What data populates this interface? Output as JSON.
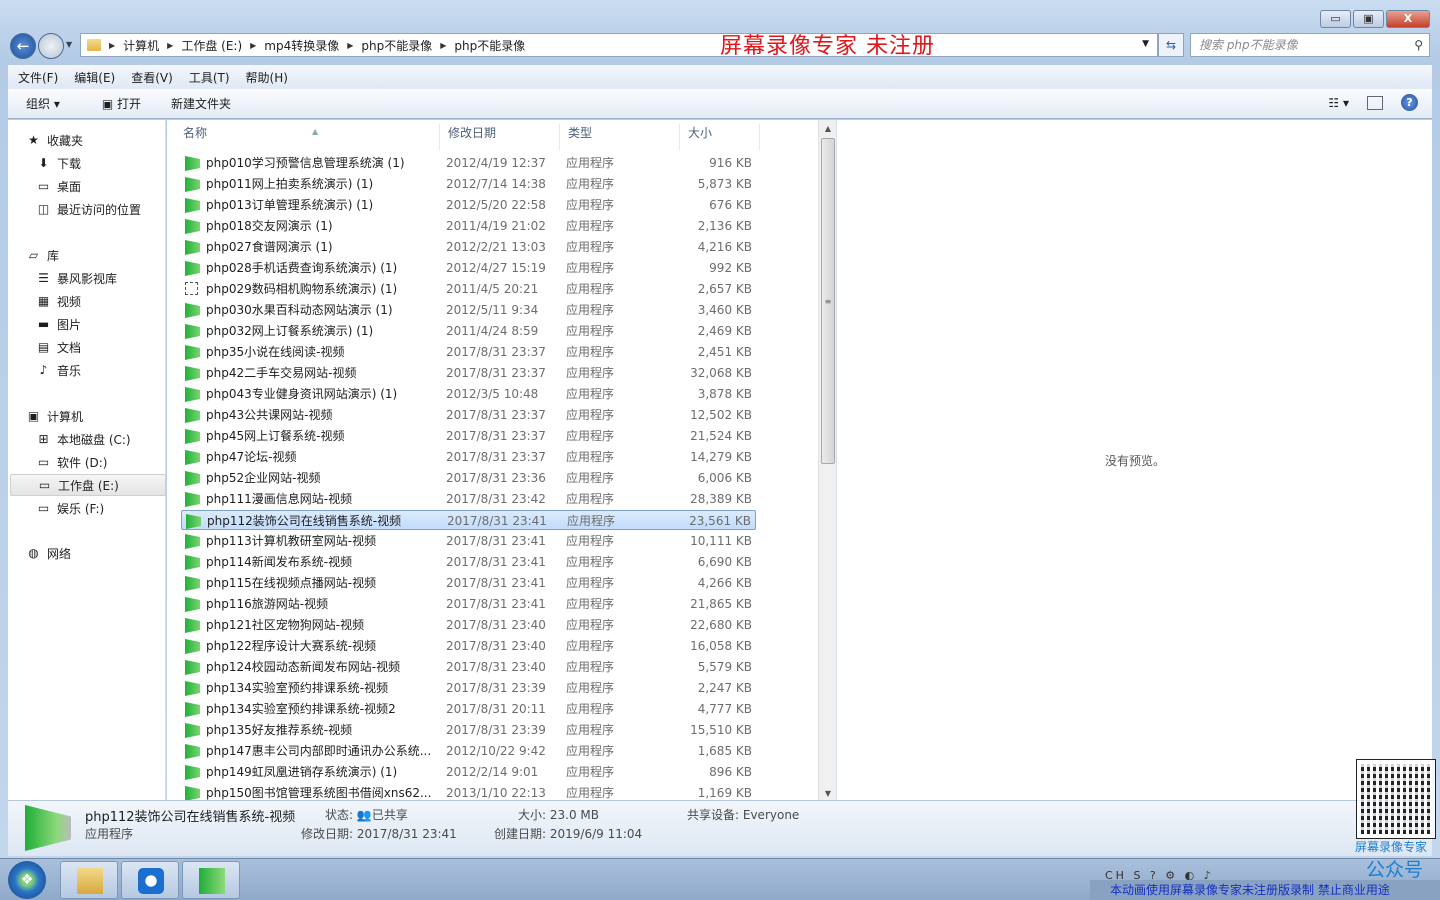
{
  "window": {
    "controls": {
      "minimize": "▭",
      "maximize": "▣",
      "close": "X"
    }
  },
  "watermark_title": "屏幕录像专家  未注册",
  "address": {
    "crumbs": [
      "计算机",
      "工作盘 (E:)",
      "mp4转换录像",
      "php不能录像",
      "php不能录像"
    ]
  },
  "search": {
    "placeholder": "搜索 php不能录像"
  },
  "menu": [
    "文件(F)",
    "编辑(E)",
    "查看(V)",
    "工具(T)",
    "帮助(H)"
  ],
  "toolbar": {
    "organize": "组织 ▾",
    "open": "打开",
    "new_folder": "新建文件夹"
  },
  "nav": {
    "favorites": {
      "label": "收藏夹",
      "items": [
        "下载",
        "桌面",
        "最近访问的位置"
      ]
    },
    "libraries": {
      "label": "库",
      "items": [
        "暴风影视库",
        "视频",
        "图片",
        "文档",
        "音乐"
      ]
    },
    "computer": {
      "label": "计算机",
      "items": [
        "本地磁盘 (C:)",
        "软件 (D:)",
        "工作盘 (E:)",
        "娱乐 (F:)"
      ],
      "selected": "工作盘 (E:)"
    },
    "network": {
      "label": "网络"
    }
  },
  "columns": [
    "名称",
    "修改日期",
    "类型",
    "大小"
  ],
  "files": [
    {
      "name": "php010学习预警信息管理系统演 (1)",
      "date": "2012/4/19 12:37",
      "type": "应用程序",
      "size": "916 KB"
    },
    {
      "name": "php011网上拍卖系统演示) (1)",
      "date": "2012/7/14 14:38",
      "type": "应用程序",
      "size": "5,873 KB"
    },
    {
      "name": "php013订单管理系统演示) (1)",
      "date": "2012/5/20 22:58",
      "type": "应用程序",
      "size": "676 KB"
    },
    {
      "name": "php018交友网演示 (1)",
      "date": "2011/4/19 21:02",
      "type": "应用程序",
      "size": "2,136 KB"
    },
    {
      "name": "php027食谱网演示 (1)",
      "date": "2012/2/21 13:03",
      "type": "应用程序",
      "size": "4,216 KB"
    },
    {
      "name": "php028手机话费查询系统演示) (1)",
      "date": "2012/4/27 15:19",
      "type": "应用程序",
      "size": "992 KB"
    },
    {
      "name": "php029数码相机购物系统演示) (1)",
      "date": "2011/4/5 20:21",
      "type": "应用程序",
      "size": "2,657 KB",
      "icon": "generic-exe"
    },
    {
      "name": "php030水果百科动态网站演示 (1)",
      "date": "2012/5/11 9:34",
      "type": "应用程序",
      "size": "3,460 KB"
    },
    {
      "name": "php032网上订餐系统演示) (1)",
      "date": "2011/4/24 8:59",
      "type": "应用程序",
      "size": "2,469 KB"
    },
    {
      "name": "php35小说在线阅读-视频",
      "date": "2017/8/31 23:37",
      "type": "应用程序",
      "size": "2,451 KB"
    },
    {
      "name": "php42二手车交易网站-视频",
      "date": "2017/8/31 23:37",
      "type": "应用程序",
      "size": "32,068 KB"
    },
    {
      "name": "php043专业健身资讯网站演示) (1)",
      "date": "2012/3/5 10:48",
      "type": "应用程序",
      "size": "3,878 KB"
    },
    {
      "name": "php43公共课网站-视频",
      "date": "2017/8/31 23:37",
      "type": "应用程序",
      "size": "12,502 KB"
    },
    {
      "name": "php45网上订餐系统-视频",
      "date": "2017/8/31 23:37",
      "type": "应用程序",
      "size": "21,524 KB"
    },
    {
      "name": "php47论坛-视频",
      "date": "2017/8/31 23:37",
      "type": "应用程序",
      "size": "14,279 KB"
    },
    {
      "name": "php52企业网站-视频",
      "date": "2017/8/31 23:36",
      "type": "应用程序",
      "size": "6,006 KB"
    },
    {
      "name": "php111漫画信息网站-视频",
      "date": "2017/8/31 23:42",
      "type": "应用程序",
      "size": "28,389 KB"
    },
    {
      "name": "php112装饰公司在线销售系统-视频",
      "date": "2017/8/31 23:41",
      "type": "应用程序",
      "size": "23,561 KB",
      "selected": true
    },
    {
      "name": "php113计算机教研室网站-视频",
      "date": "2017/8/31 23:41",
      "type": "应用程序",
      "size": "10,111 KB"
    },
    {
      "name": "php114新闻发布系统-视频",
      "date": "2017/8/31 23:41",
      "type": "应用程序",
      "size": "6,690 KB"
    },
    {
      "name": "php115在线视频点播网站-视频",
      "date": "2017/8/31 23:41",
      "type": "应用程序",
      "size": "4,266 KB"
    },
    {
      "name": "php116旅游网站-视频",
      "date": "2017/8/31 23:41",
      "type": "应用程序",
      "size": "21,865 KB"
    },
    {
      "name": "php121社区宠物狗网站-视频",
      "date": "2017/8/31 23:40",
      "type": "应用程序",
      "size": "22,680 KB"
    },
    {
      "name": "php122程序设计大赛系统-视频",
      "date": "2017/8/31 23:40",
      "type": "应用程序",
      "size": "16,058 KB"
    },
    {
      "name": "php124校园动态新闻发布网站-视频",
      "date": "2017/8/31 23:40",
      "type": "应用程序",
      "size": "5,579 KB"
    },
    {
      "name": "php134实验室预约排课系统-视频",
      "date": "2017/8/31 23:39",
      "type": "应用程序",
      "size": "2,247 KB"
    },
    {
      "name": "php134实验室预约排课系统-视频2",
      "date": "2017/8/31 20:11",
      "type": "应用程序",
      "size": "4,777 KB"
    },
    {
      "name": "php135好友推荐系统-视频",
      "date": "2017/8/31 23:39",
      "type": "应用程序",
      "size": "15,510 KB"
    },
    {
      "name": "php147惠丰公司内部即时通讯办公系统...",
      "date": "2012/10/22 9:42",
      "type": "应用程序",
      "size": "1,685 KB"
    },
    {
      "name": "php149虹凤凰进销存系统演示) (1)",
      "date": "2012/2/14 9:01",
      "type": "应用程序",
      "size": "896 KB"
    },
    {
      "name": "php150图书馆管理系统图书借阅xns62...",
      "date": "2013/1/10 22:13",
      "type": "应用程序",
      "size": "1,169 KB"
    }
  ],
  "preview": {
    "empty_text": "没有预览。"
  },
  "details": {
    "name": "php112装饰公司在线销售系统-视频",
    "type": "应用程序",
    "state_label": "状态:",
    "state": "已共享",
    "modified_label": "修改日期:",
    "modified": "2017/8/31 23:41",
    "size_label": "大小:",
    "size": "23.0 MB",
    "created_label": "创建日期:",
    "created": "2019/6/9 11:04",
    "shared_label": "共享设备:",
    "shared": "Everyone"
  },
  "taskbar": {
    "tray_text": "CH",
    "banner": "本动画使用屏幕录像专家未注册版录制  禁止商业用途"
  },
  "qr": {
    "line1": "屏幕录像专家",
    "line2": "公众号"
  },
  "colors": {
    "watermark": "#e0161b",
    "selection": "#c1dcfc",
    "qr_text": "#1b7fd0"
  }
}
